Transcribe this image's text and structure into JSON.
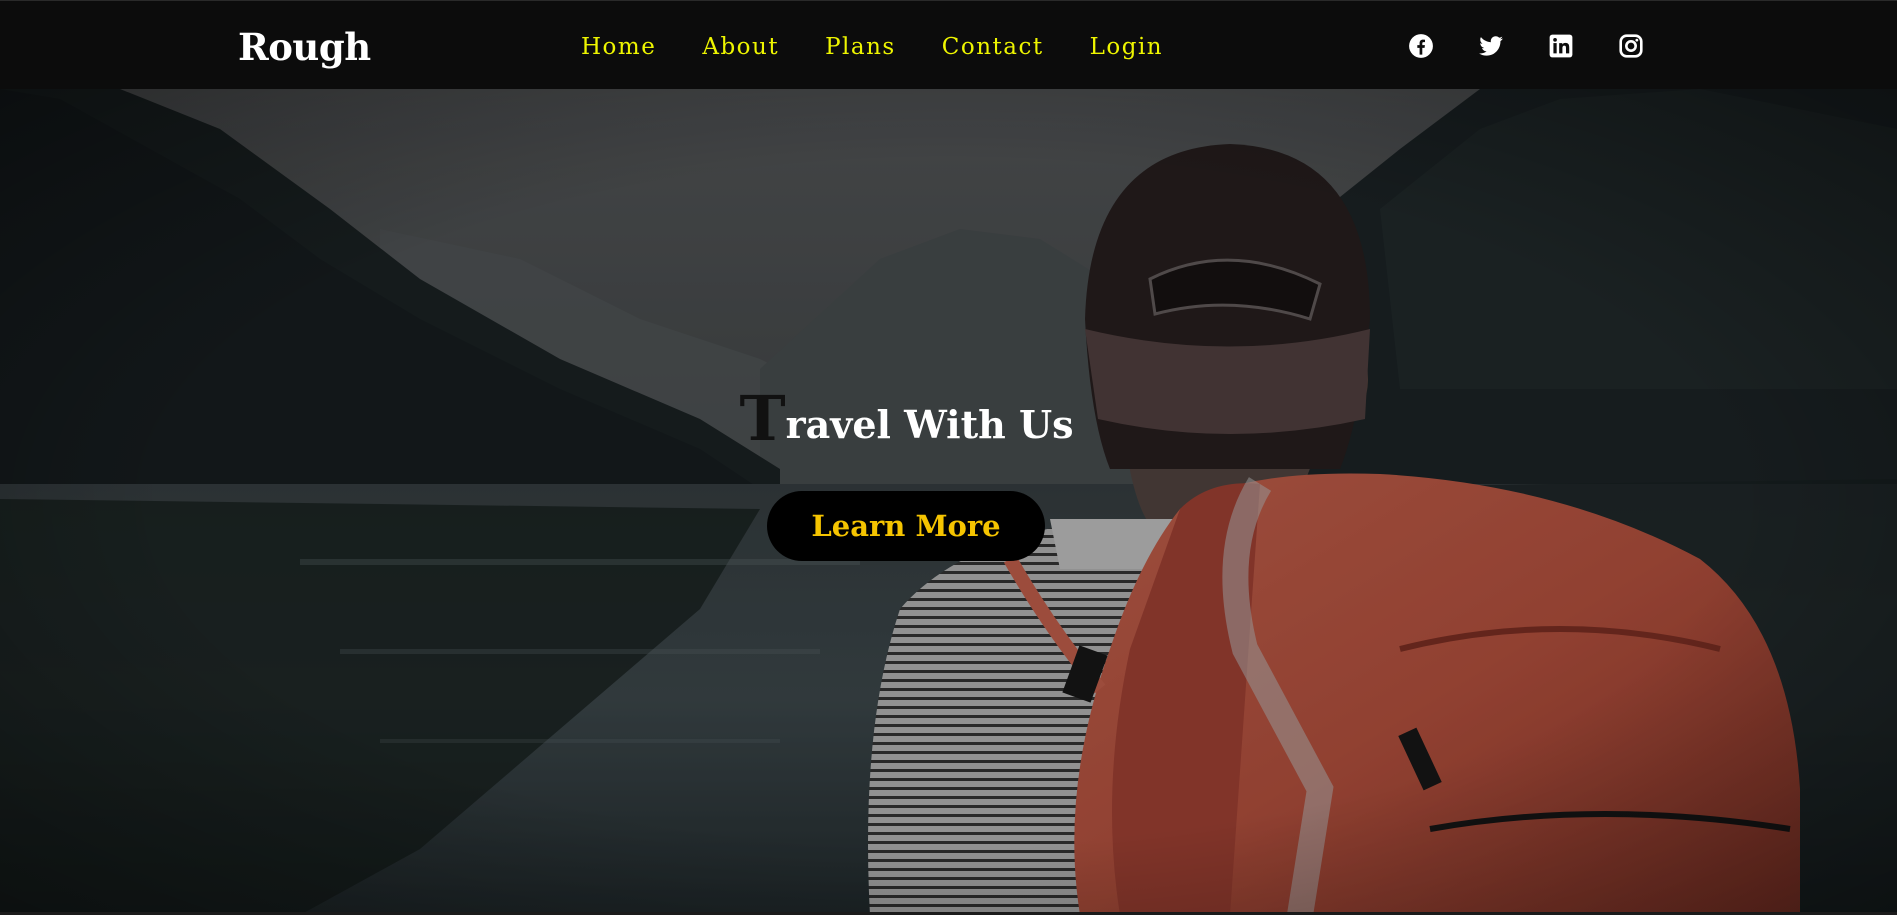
{
  "brand": {
    "name": "Rough"
  },
  "nav": {
    "items": [
      {
        "label": "Home"
      },
      {
        "label": "About"
      },
      {
        "label": "Plans"
      },
      {
        "label": "Contact"
      },
      {
        "label": "Login"
      }
    ]
  },
  "socials": [
    {
      "icon": "facebook-icon"
    },
    {
      "icon": "twitter-icon"
    },
    {
      "icon": "linkedin-icon"
    },
    {
      "icon": "instagram-icon"
    }
  ],
  "hero": {
    "title_first_letter": "T",
    "title_rest": "ravel With Us",
    "cta_label": "Learn More",
    "background_image": "traveler-with-orange-backpack-at-mountain-lake"
  },
  "colors": {
    "navbar_bg": "#0c0c0c",
    "nav_link": "#eef500",
    "brand_text": "#ffffff",
    "cta_bg": "#000000",
    "cta_text": "#f5c400"
  }
}
